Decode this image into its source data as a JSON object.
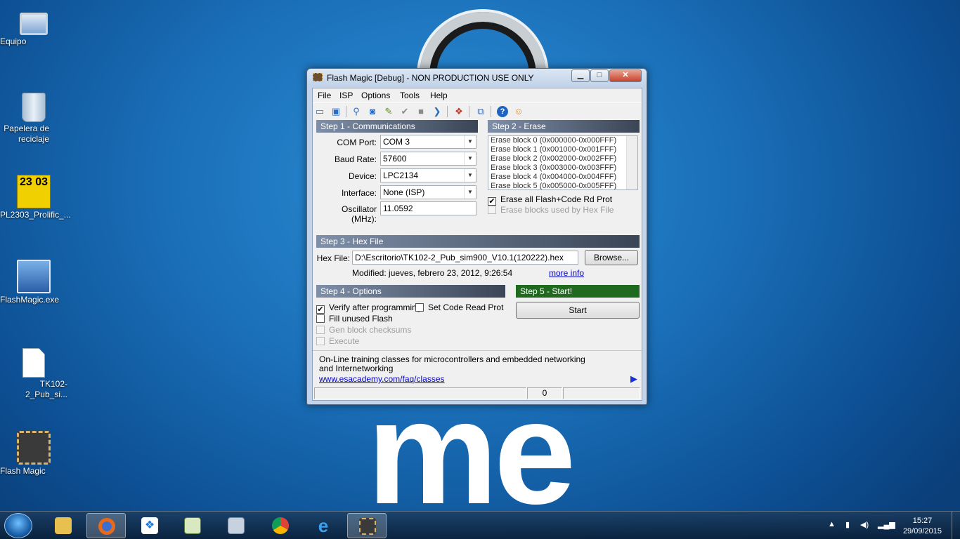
{
  "desktop": {
    "icons": [
      {
        "label": "Equipo",
        "icon": "computer-icon"
      },
      {
        "label": "Papelera de reciclaje",
        "icon": "recycle-bin-icon"
      },
      {
        "label": "PL2303_Prolific_...",
        "icon": "installer-icon",
        "glyph": "23 03"
      },
      {
        "label": "FlashMagic.exe",
        "icon": "setup-exe-icon"
      },
      {
        "label": "TK102-2_Pub_si...",
        "icon": "document-icon"
      },
      {
        "label": "Flash Magic",
        "icon": "chip-icon"
      }
    ],
    "wallpaper_text": "me"
  },
  "window": {
    "title": "Flash Magic [Debug] - NON PRODUCTION USE ONLY",
    "buttons": {
      "minimize": "▁",
      "maximize": "□",
      "close": "✕"
    },
    "menu": [
      "File",
      "ISP",
      "Options",
      "Tools",
      "Help"
    ],
    "toolbar_icons": [
      "open-icon",
      "save-icon",
      "search-icon",
      "database-icon",
      "erase-icon",
      "verify-icon",
      "blank-check-icon",
      "go-icon",
      "recycle-icon",
      "zoom-icon",
      "help-icon",
      "users-icon"
    ],
    "step1": {
      "header": "Step 1 - Communications",
      "com_port_label": "COM Port:",
      "com_port_value": "COM 3",
      "baud_rate_label": "Baud Rate:",
      "baud_rate_value": "57600",
      "device_label": "Device:",
      "device_value": "LPC2134",
      "interface_label": "Interface:",
      "interface_value": "None (ISP)",
      "oscillator_label": "Oscillator (MHz):",
      "oscillator_value": "11.0592"
    },
    "step2": {
      "header": "Step 2 - Erase",
      "blocks": [
        "Erase block 0 (0x000000-0x000FFF)",
        "Erase block 1 (0x001000-0x001FFF)",
        "Erase block 2 (0x002000-0x002FFF)",
        "Erase block 3 (0x003000-0x003FFF)",
        "Erase block 4 (0x004000-0x004FFF)",
        "Erase block 5 (0x005000-0x005FFF)"
      ],
      "erase_all_label": "Erase all Flash+Code Rd Prot",
      "erase_all_checked": true,
      "erase_hex_label": "Erase blocks used by Hex File",
      "erase_hex_checked": false
    },
    "step3": {
      "header": "Step 3 - Hex File",
      "hex_label": "Hex File:",
      "hex_value": "D:\\Escritorio\\TK102-2_Pub_sim900_V10.1(120222).hex",
      "browse_label": "Browse...",
      "modified_text": "Modified: jueves, febrero 23, 2012, 9:26:54",
      "more_info_label": "more info"
    },
    "step4": {
      "header": "Step 4 - Options",
      "verify_label": "Verify after programming",
      "verify_checked": true,
      "code_read_label": "Set Code Read Prot",
      "code_read_checked": false,
      "fill_label": "Fill unused Flash",
      "fill_checked": false,
      "gen_label": "Gen block checksums",
      "gen_checked": false,
      "execute_label": "Execute",
      "execute_checked": false
    },
    "step5": {
      "header": "Step 5 - Start!",
      "start_label": "Start"
    },
    "ad": {
      "text": "On-Line training classes for microcontrollers and embedded networking and Internetworking",
      "link": "www.esacademy.com/faq/classes",
      "next_icon": "▶"
    },
    "status": {
      "count": "0"
    }
  },
  "taskbar": {
    "apps": [
      "file-explorer-icon",
      "firefox-icon",
      "dropbox-icon",
      "editor-icon",
      "calculator-icon",
      "chrome-icon",
      "internet-explorer-icon",
      "flash-magic-icon"
    ],
    "clock_time": "15:27",
    "clock_date": "29/09/2015",
    "tray_icons": [
      "show-hidden-icon",
      "battery-icon",
      "volume-icon",
      "signal-icon"
    ]
  }
}
